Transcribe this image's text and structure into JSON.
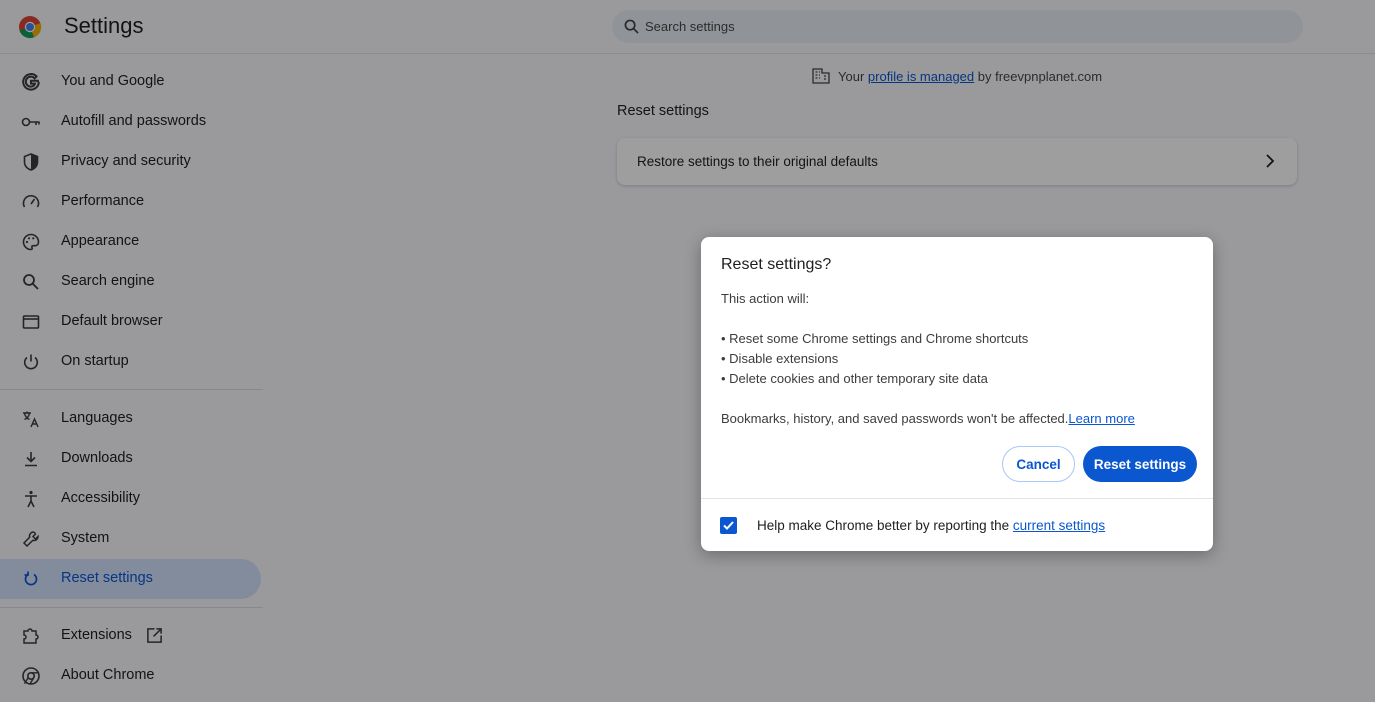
{
  "app": {
    "title": "Settings"
  },
  "search": {
    "placeholder": "Search settings"
  },
  "sidebar": {
    "items": [
      {
        "label": "You and Google",
        "icon": "google-icon"
      },
      {
        "label": "Autofill and passwords",
        "icon": "key-icon"
      },
      {
        "label": "Privacy and security",
        "icon": "shield-icon"
      },
      {
        "label": "Performance",
        "icon": "speedometer-icon"
      },
      {
        "label": "Appearance",
        "icon": "palette-icon"
      },
      {
        "label": "Search engine",
        "icon": "search-icon"
      },
      {
        "label": "Default browser",
        "icon": "browser-window-icon"
      },
      {
        "label": "On startup",
        "icon": "power-icon"
      },
      {
        "label": "Languages",
        "icon": "translate-icon"
      },
      {
        "label": "Downloads",
        "icon": "download-icon"
      },
      {
        "label": "Accessibility",
        "icon": "accessibility-icon"
      },
      {
        "label": "System",
        "icon": "wrench-icon"
      },
      {
        "label": "Reset settings",
        "icon": "reset-icon",
        "active": true
      },
      {
        "label": "Extensions",
        "icon": "puzzle-icon"
      },
      {
        "label": "About Chrome",
        "icon": "chrome-icon"
      }
    ]
  },
  "managed": {
    "prefix": "Your",
    "link": "profile is managed",
    "suffix": "by freevpnplanet.com"
  },
  "main": {
    "section_title": "Reset settings",
    "card_label": "Restore settings to their original defaults"
  },
  "dialog": {
    "title": "Reset settings?",
    "intro": "This action will:",
    "bullets": [
      "• Reset some Chrome settings and Chrome shortcuts",
      "• Disable extensions",
      "• Delete cookies and other temporary site data"
    ],
    "note": "Bookmarks, history, and saved passwords won't be affected.",
    "learn_more": "Learn more",
    "cancel_label": "Cancel",
    "reset_label": "Reset settings",
    "checkbox_label": "Help make Chrome better by reporting the",
    "checkbox_link": "current settings",
    "checkbox_checked": true
  },
  "colors": {
    "accent": "#0b57d0",
    "active_bg": "#d3e3fd"
  }
}
